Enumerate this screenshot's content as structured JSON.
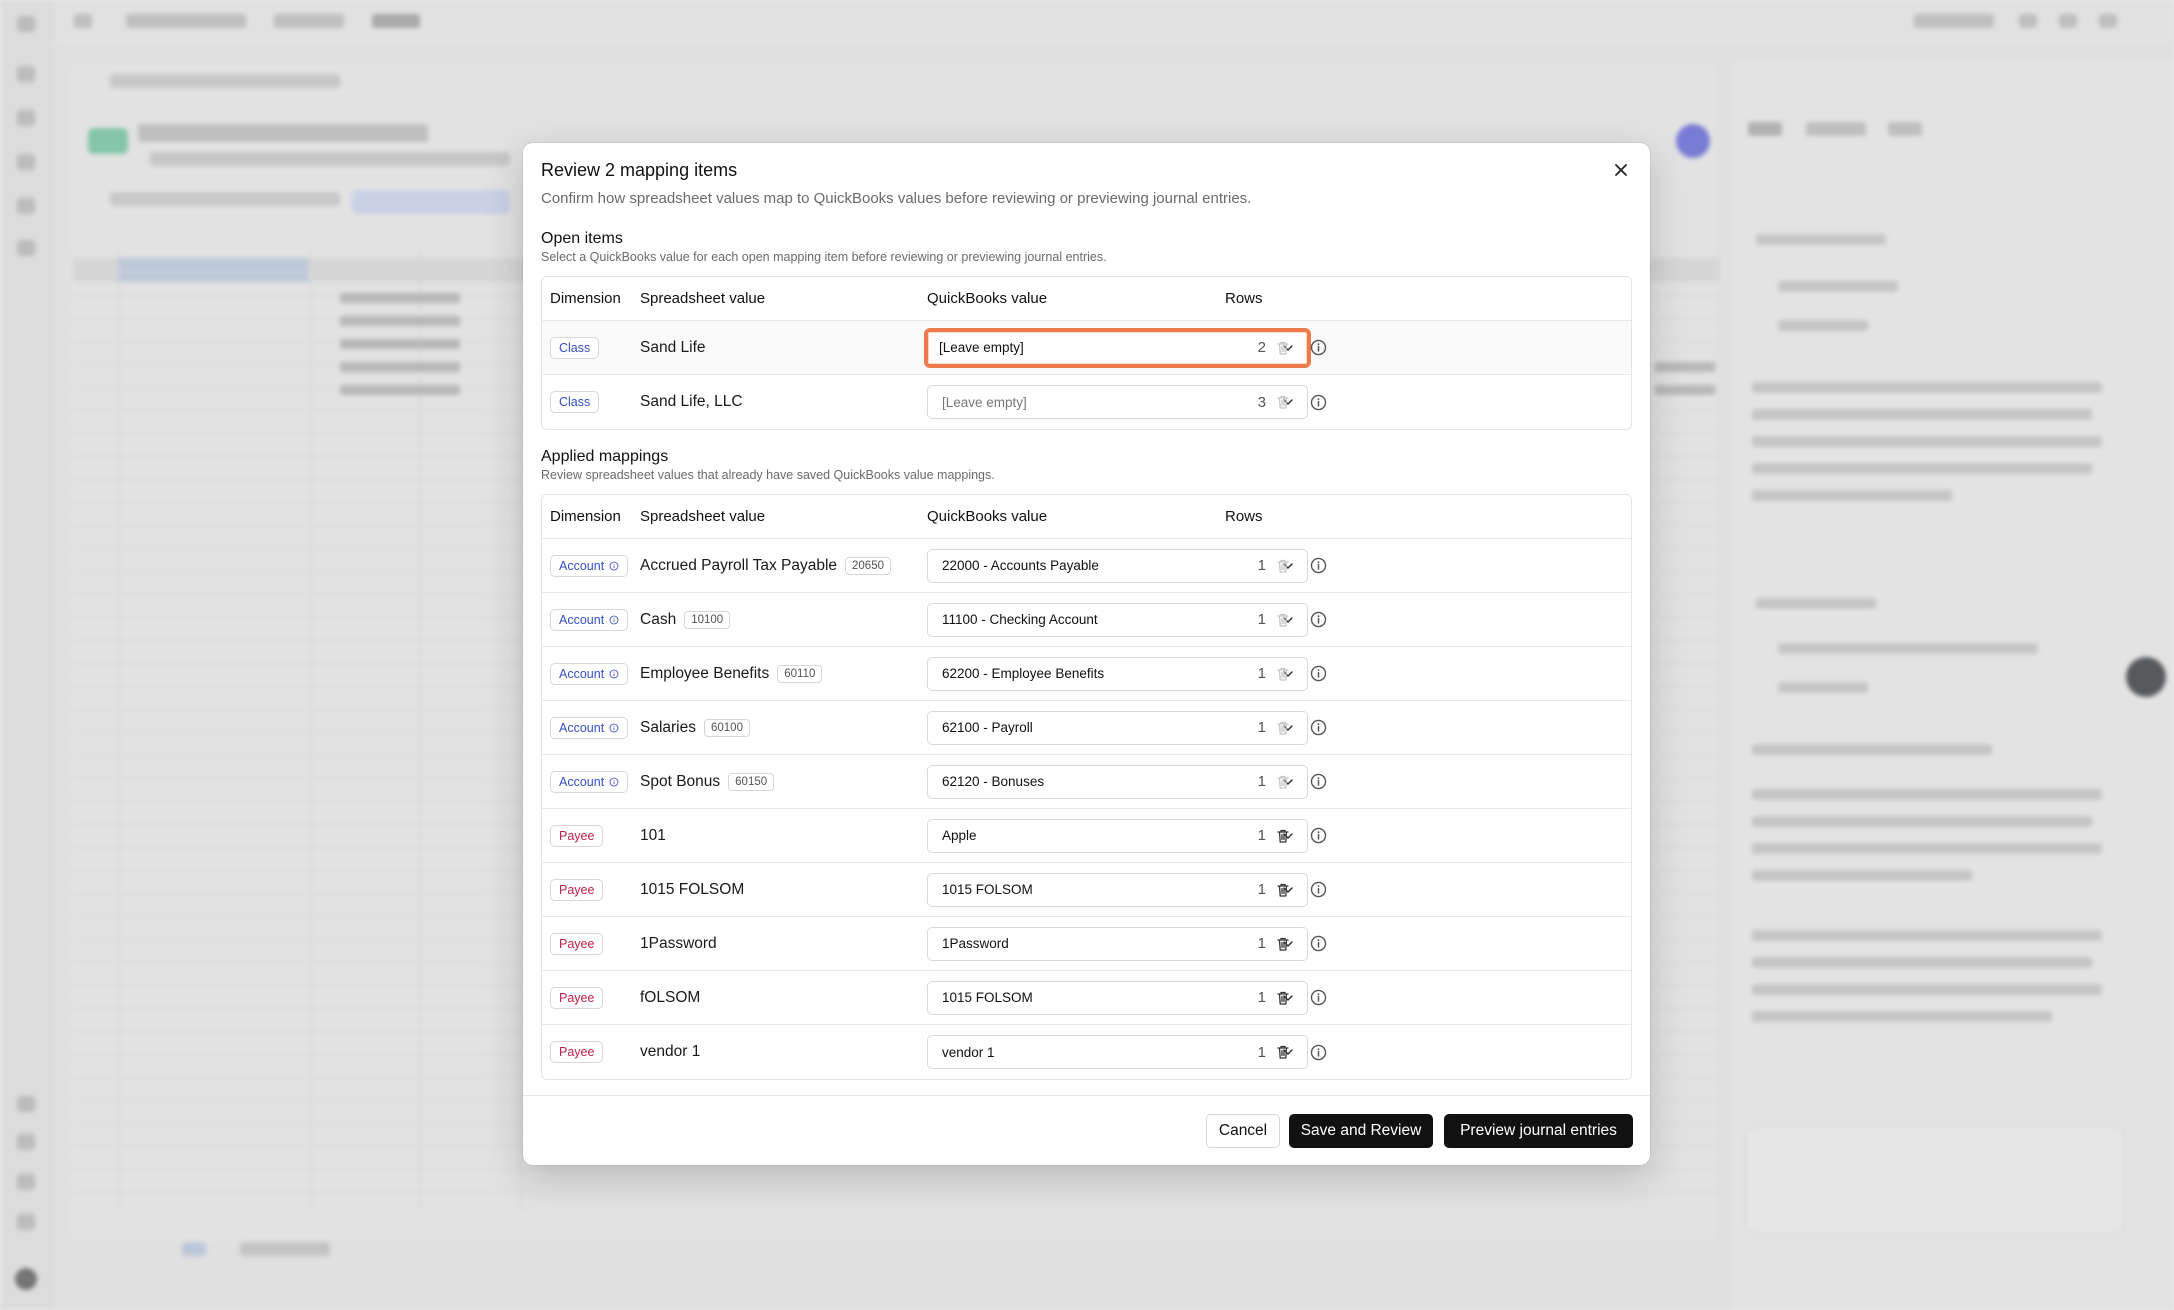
{
  "modal": {
    "title": "Review 2 mapping items",
    "subtitle": "Confirm how spreadsheet values map to QuickBooks values before reviewing or previewing journal entries."
  },
  "open_items": {
    "title": "Open items",
    "subtitle": "Select a QuickBooks value for each open mapping item before reviewing or previewing journal entries.",
    "columns": [
      "Dimension",
      "Spreadsheet value",
      "QuickBooks value",
      "Rows"
    ],
    "rows": [
      {
        "dimension": "Class",
        "value": "Sand Life",
        "qb": "[Leave empty]",
        "rows": "2"
      },
      {
        "dimension": "Class",
        "value": "Sand Life, LLC",
        "qb": "[Leave empty]",
        "rows": "3"
      }
    ]
  },
  "applied": {
    "title": "Applied mappings",
    "subtitle": "Review spreadsheet values that already have saved QuickBooks value mappings.",
    "columns": [
      "Dimension",
      "Spreadsheet value",
      "QuickBooks value",
      "Rows"
    ],
    "rows": [
      {
        "dimension": "Account",
        "value": "Accrued Payroll Tax Payable",
        "code": "20650",
        "qb": "22000 - Accounts Payable",
        "rows": "1"
      },
      {
        "dimension": "Account",
        "value": "Cash",
        "code": "10100",
        "qb": "11100 - Checking Account",
        "rows": "1"
      },
      {
        "dimension": "Account",
        "value": "Employee Benefits",
        "code": "60110",
        "qb": "62200 - Employee Benefits",
        "rows": "1"
      },
      {
        "dimension": "Account",
        "value": "Salaries",
        "code": "60100",
        "qb": "62100 - Payroll",
        "rows": "1"
      },
      {
        "dimension": "Account",
        "value": "Spot Bonus",
        "code": "60150",
        "qb": "62120 - Bonuses",
        "rows": "1"
      },
      {
        "dimension": "Payee",
        "value": "101",
        "code": "",
        "qb": "Apple",
        "rows": "1"
      },
      {
        "dimension": "Payee",
        "value": "1015 FOLSOM",
        "code": "",
        "qb": "1015 FOLSOM",
        "rows": "1"
      },
      {
        "dimension": "Payee",
        "value": "1Password",
        "code": "",
        "qb": "1Password",
        "rows": "1"
      },
      {
        "dimension": "Payee",
        "value": "fOLSOM",
        "code": "",
        "qb": "1015 FOLSOM",
        "rows": "1"
      },
      {
        "dimension": "Payee",
        "value": "vendor 1",
        "code": "",
        "qb": "vendor 1",
        "rows": "1"
      }
    ]
  },
  "footer": {
    "cancel": "Cancel",
    "save": "Save and Review",
    "preview": "Preview journal entries"
  },
  "colors": {
    "focus_ring": "#ec7a4a",
    "class_badge": "#3550c4",
    "payee_badge": "#c0234a",
    "primary_button": "#111111"
  }
}
